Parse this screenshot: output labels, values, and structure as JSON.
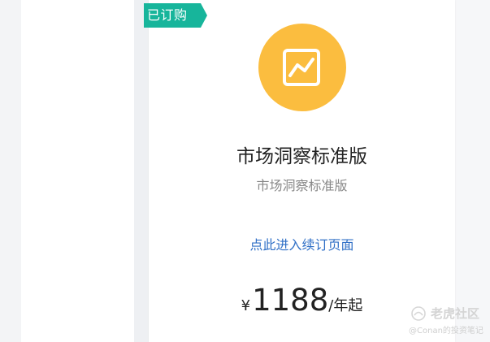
{
  "card": {
    "badge_label": "已订购",
    "icon": "line-chart-icon",
    "title": "市场洞察标准版",
    "subtitle": "市场洞察标准版",
    "renew_link": "点此进入续订页面",
    "price": {
      "currency": "¥",
      "amount": "1188",
      "unit": "/年起"
    }
  },
  "watermark": {
    "brand": "老虎社区",
    "handle": "@Conan的投资笔记"
  },
  "colors": {
    "badge": "#17b59b",
    "icon_circle": "#fbbd3f",
    "link": "#2f6fc6"
  }
}
